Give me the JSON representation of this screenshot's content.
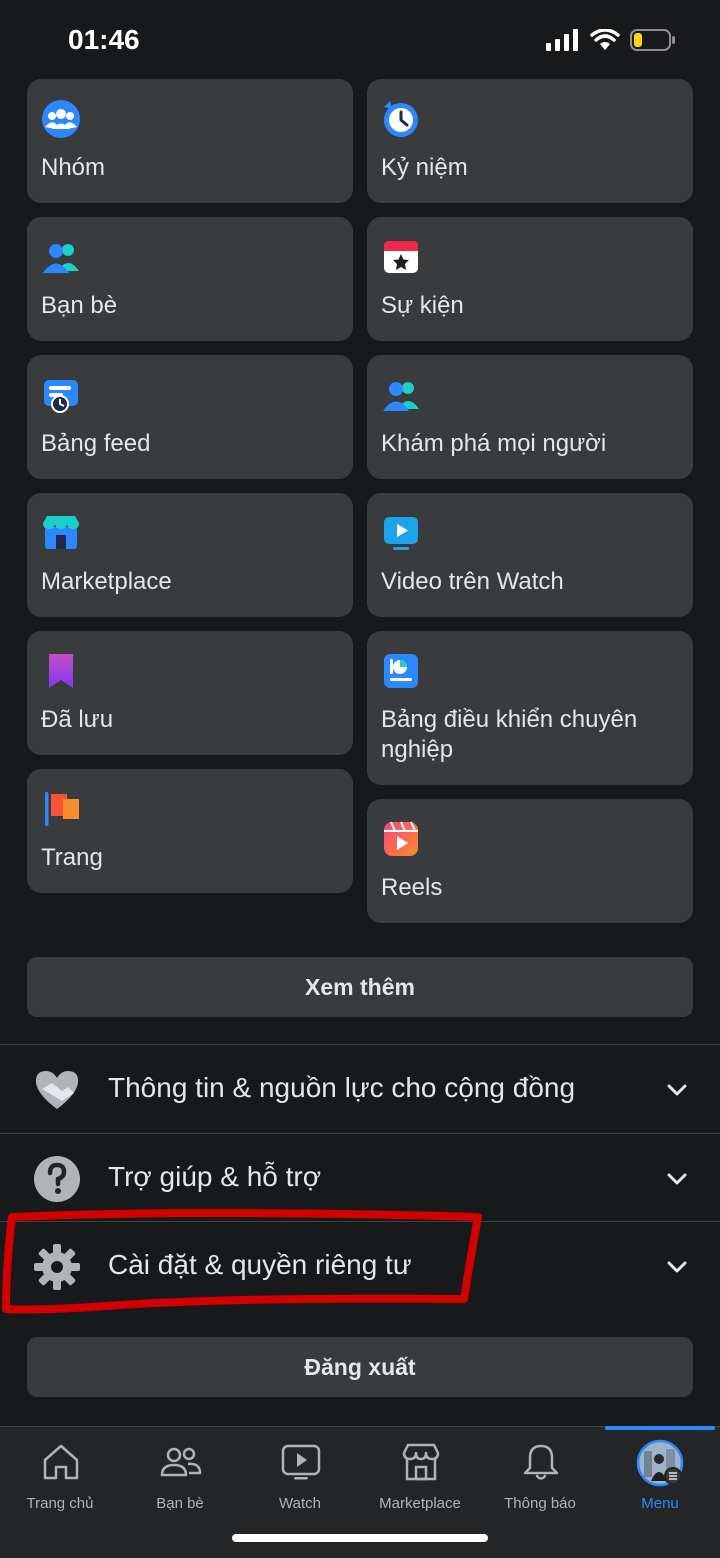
{
  "status": {
    "time": "01:46"
  },
  "tiles": {
    "groups": "Nhóm",
    "memories": "Kỷ niệm",
    "friends": "Bạn bè",
    "events": "Sự kiện",
    "feeds": "Bảng feed",
    "discover_people": "Khám phá mọi người",
    "marketplace": "Marketplace",
    "watch_video": "Video trên Watch",
    "saved": "Đã lưu",
    "professional_dashboard": "Bảng điều khiển chuyên nghiệp",
    "pages": "Trang",
    "reels": "Reels"
  },
  "see_more": "Xem thêm",
  "sections": {
    "community": "Thông tin & nguồn lực cho cộng đồng",
    "help": "Trợ giúp & hỗ trợ",
    "settings": "Cài đặt & quyền riêng tư"
  },
  "logout": "Đăng xuất",
  "tabs": {
    "home": "Trang chủ",
    "friends": "Bạn bè",
    "watch": "Watch",
    "marketplace": "Marketplace",
    "notifications": "Thông báo",
    "menu": "Menu"
  },
  "colors": {
    "accent": "#2d88ff",
    "highlight": "#d30000",
    "background": "#18191a",
    "tile": "#3a3b3c"
  }
}
